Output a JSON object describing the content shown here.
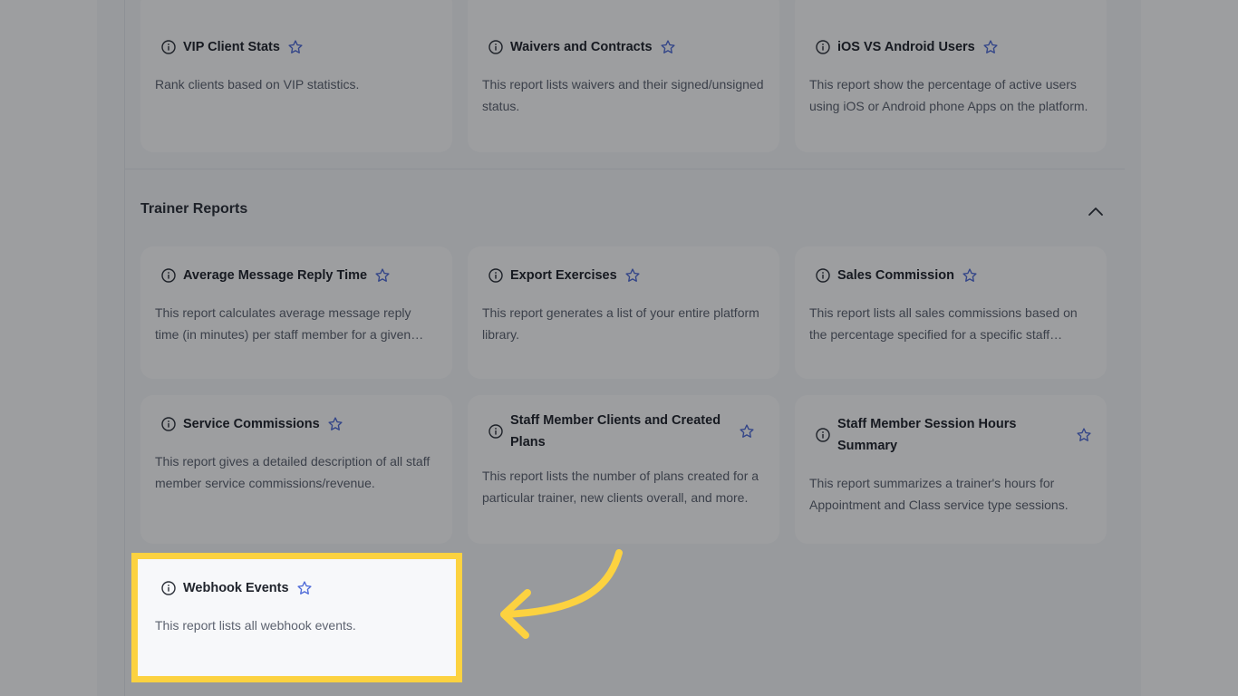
{
  "top_cards": [
    {
      "title": "VIP Client Stats",
      "desc": "Rank clients based on VIP statistics."
    },
    {
      "title": "Waivers and Contracts",
      "desc": "This report lists waivers and their signed/unsigned status."
    },
    {
      "title": "iOS VS Android Users",
      "desc": "This report show the percentage of active users using iOS or Android phone Apps on the platform."
    }
  ],
  "section": {
    "title": "Trainer Reports"
  },
  "trainer_cards": [
    {
      "title": "Average Message Reply Time",
      "desc": "This report calculates average message reply time (in minutes) per staff member for a given period."
    },
    {
      "title": "Export Exercises",
      "desc": "This report generates a list of your entire platform library."
    },
    {
      "title": "Sales Commission",
      "desc": "This report lists all sales commissions based on the percentage specified for a specific staff member."
    },
    {
      "title": "Service Commissions",
      "desc": "This report gives a detailed description of all staff member service commissions/revenue."
    },
    {
      "title": "Staff Member Clients and Created Plans",
      "desc": "This report lists the number of plans created for a particular trainer, new clients overall, and more."
    },
    {
      "title": "Staff Member Session Hours Summary",
      "desc": "This report summarizes a trainer's hours for Appointment and Class service type sessions."
    }
  ],
  "highlighted_card": {
    "title": "Webhook Events",
    "desc": "This report lists all webhook events."
  },
  "colors": {
    "highlight": "#fcd240",
    "star": "#4f6bd8",
    "arrow": "#fcd240"
  },
  "icons": {
    "info": "info-circle-icon",
    "star": "star-outline-icon",
    "collapse": "chevron-up-icon",
    "arrow": "curved-arrow-icon"
  }
}
